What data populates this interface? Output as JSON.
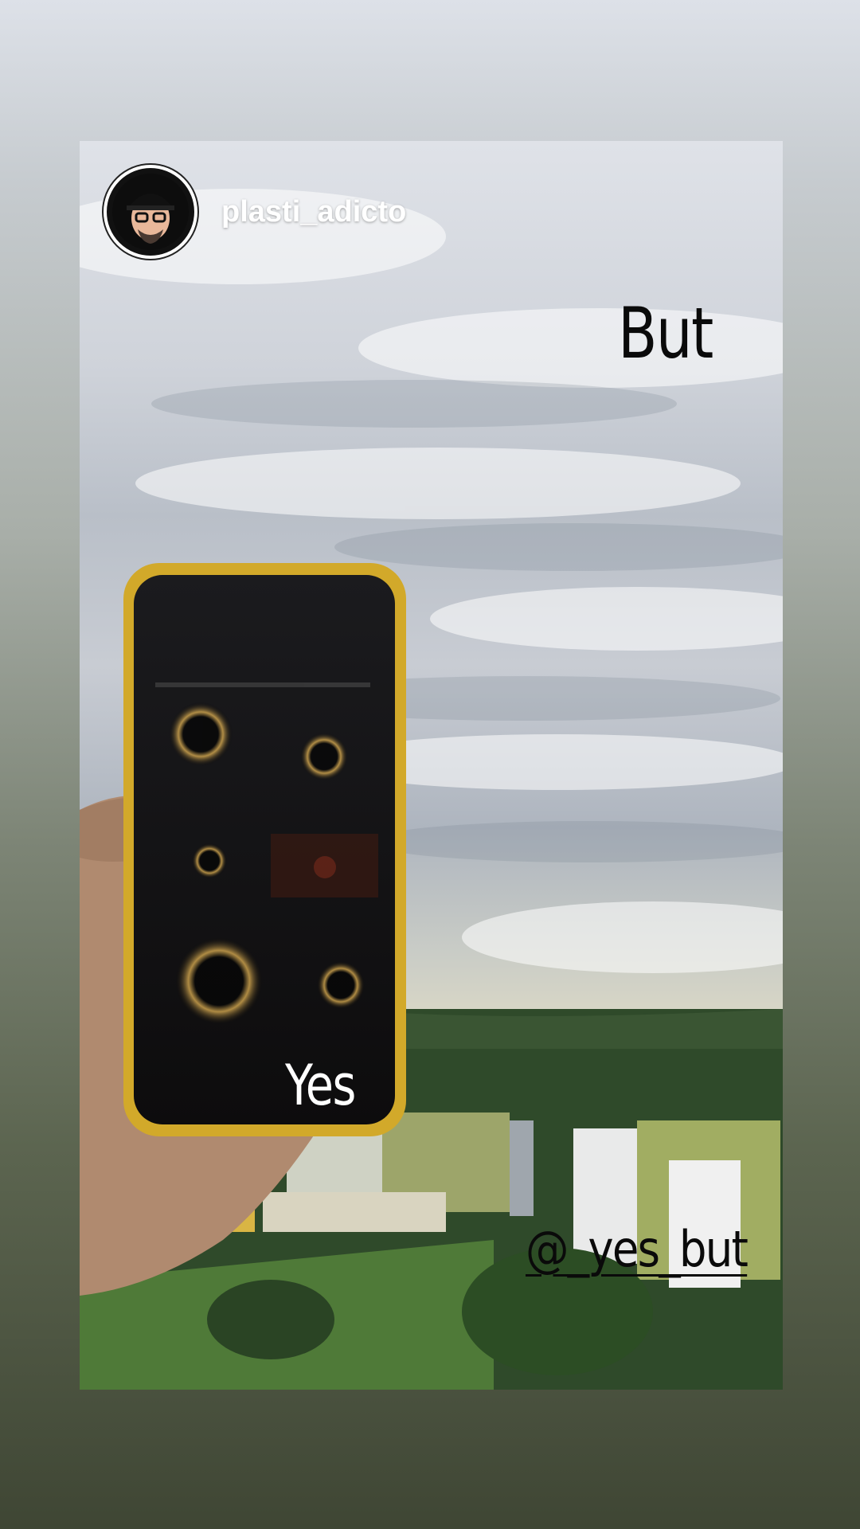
{
  "story": {
    "username": "plasti_adicto",
    "captions": {
      "top": "But",
      "phone": "Yes",
      "handle": "@_yes_but"
    }
  },
  "colors": {
    "frame_background_top": "#dde1e8",
    "frame_background_bottom": "#3f4634",
    "phone_case": "#d2a92a",
    "username_text": "#ffffff"
  },
  "icons": [
    "avatar-cartoon-icon"
  ]
}
